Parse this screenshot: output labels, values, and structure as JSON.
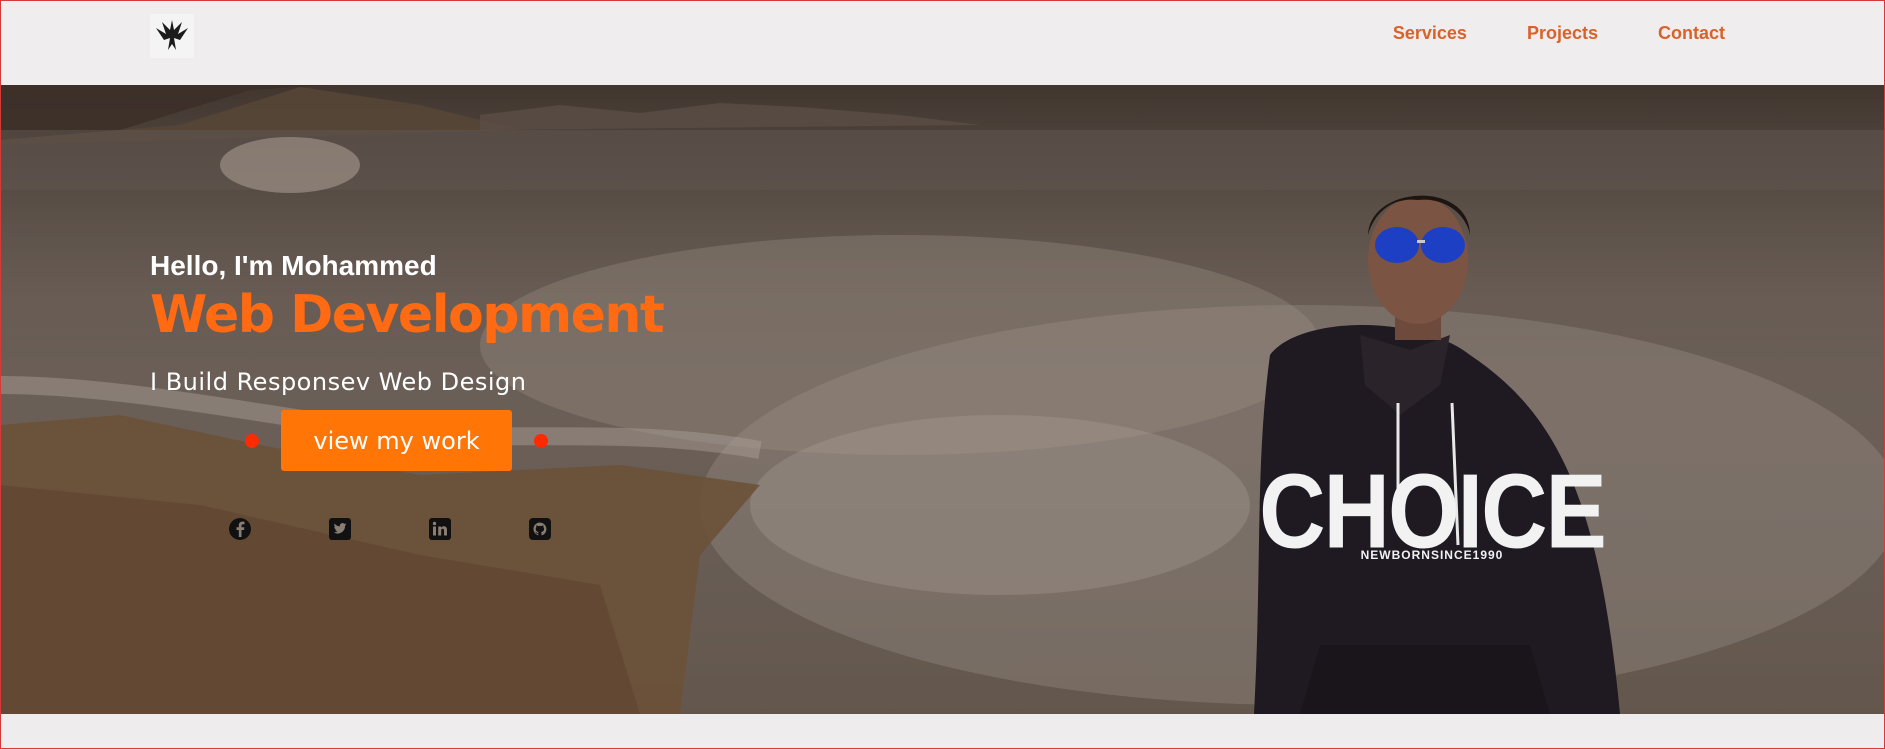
{
  "header": {
    "logo_icon": "phoenix-logo-icon",
    "nav": [
      {
        "label": "Services"
      },
      {
        "label": "Projects"
      },
      {
        "label": "Contact"
      }
    ]
  },
  "hero": {
    "greeting": "Hello, I'm Mohammed",
    "role": "Web Development",
    "tagline": "I Build Responsev Web Design",
    "cta_label": "view my work",
    "socials": [
      "facebook-icon",
      "twitter-icon",
      "linkedin-icon",
      "github-icon"
    ],
    "shirt_text": "CHOICE",
    "shirt_subtext": "NEWBORNSINCE1990"
  },
  "colors": {
    "accent": "#ff6a13",
    "nav": "#d9622b",
    "button": "#ff7506",
    "dot": "#ff2a00"
  }
}
